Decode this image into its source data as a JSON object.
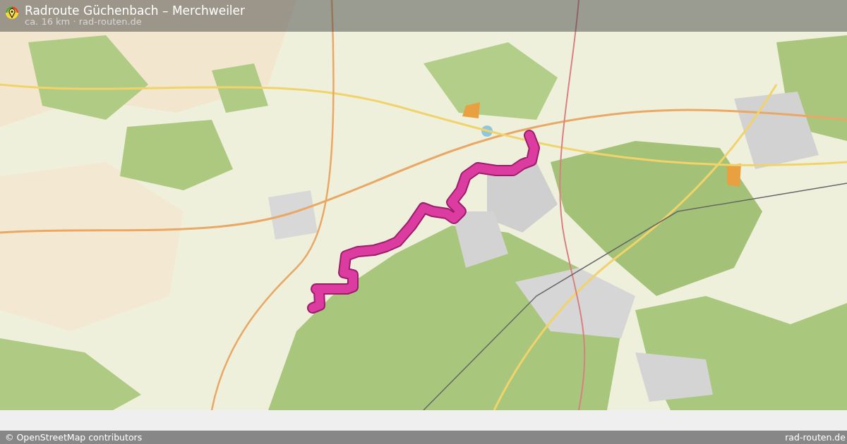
{
  "header": {
    "title": "Radroute Güchenbach – Merchweiler",
    "subtitle": "ca. 16 km · rad-routen.de"
  },
  "footer": {
    "attribution": "© OpenStreetMap contributors",
    "brand": "rad-routen.de"
  }
}
